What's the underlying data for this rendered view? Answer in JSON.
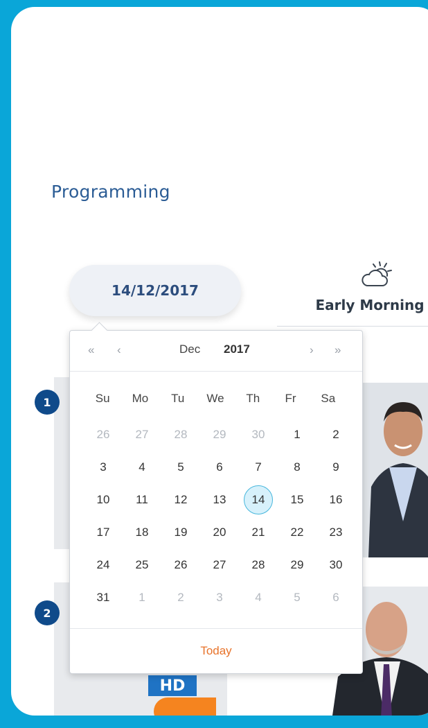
{
  "section": {
    "title": "Programming"
  },
  "date_selector": {
    "value": "14/12/2017"
  },
  "weather": {
    "label": "Early Morning",
    "icon": "cloud-sun-icon"
  },
  "datepicker": {
    "nav": {
      "prev_year": "«",
      "prev_month": "‹",
      "next_month": "›",
      "next_year": "»"
    },
    "month": "Dec",
    "year": "2017",
    "weekdays": [
      "Su",
      "Mo",
      "Tu",
      "We",
      "Th",
      "Fr",
      "Sa"
    ],
    "weeks": [
      [
        "26",
        "27",
        "28",
        "29",
        "30",
        "1",
        "2"
      ],
      [
        "3",
        "4",
        "5",
        "6",
        "7",
        "8",
        "9"
      ],
      [
        "10",
        "11",
        "12",
        "13",
        "14",
        "15",
        "16"
      ],
      [
        "17",
        "18",
        "19",
        "20",
        "21",
        "22",
        "23"
      ],
      [
        "24",
        "25",
        "26",
        "27",
        "28",
        "29",
        "30"
      ],
      [
        "31",
        "1",
        "2",
        "3",
        "4",
        "5",
        "6"
      ]
    ],
    "selected_day": "14",
    "today_label": "Today"
  },
  "programs": [
    {
      "number": "1"
    },
    {
      "number": "2",
      "channel_badge": "HD"
    }
  ],
  "colors": {
    "frame": "#0aa6d8",
    "title": "#2b5c95",
    "badge": "#0f4a8a",
    "today_link": "#e8732a",
    "selected": "#d7f1fb"
  }
}
